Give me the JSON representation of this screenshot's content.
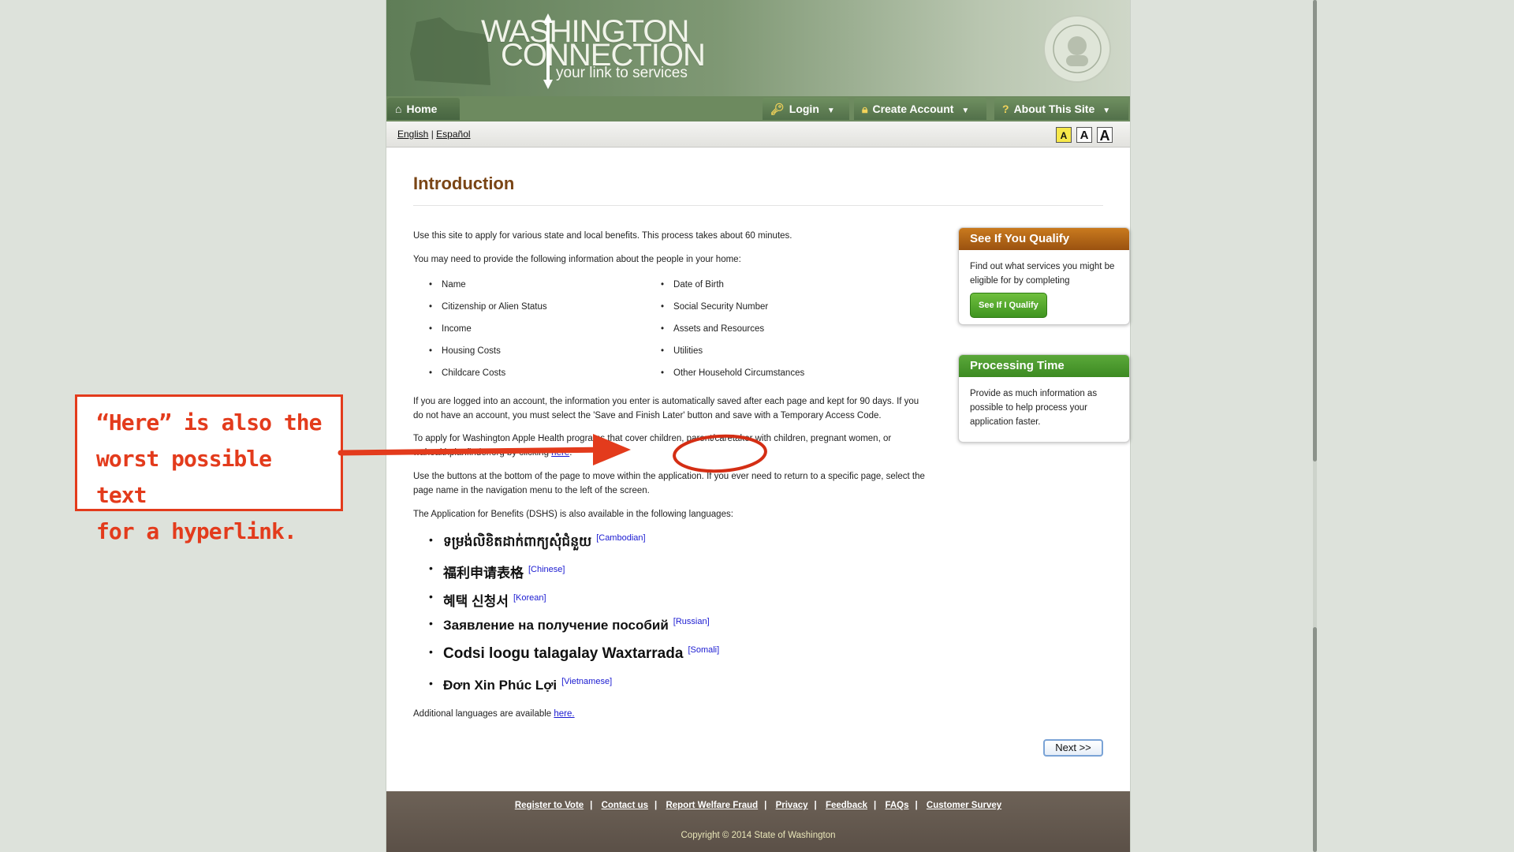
{
  "header": {
    "logo_line1": "WASHINGTON",
    "logo_line2": "CONNECTION",
    "tagline": "your link to services",
    "seal_icon": "state-seal-icon"
  },
  "nav": {
    "home": "Home",
    "login": "Login",
    "create_account": "Create Account",
    "about": "About This Site"
  },
  "langbar": {
    "english": "English",
    "separator": "|",
    "espanol": "Español",
    "size_small": "A",
    "size_medium": "A",
    "size_large": "A"
  },
  "main": {
    "title": "Introduction",
    "p1": "Use this site to apply for various state and local benefits.  This process takes about 60 minutes.",
    "p2": "You may need to provide the following information about the people in your home:",
    "info_left": [
      "Name",
      "Citizenship or Alien Status",
      "Income",
      "Housing Costs",
      "Childcare Costs"
    ],
    "info_right": [
      "Date of Birth",
      "Social Security Number",
      "Assets and Resources",
      "Utilities",
      "Other Household Circumstances"
    ],
    "p3": "If you are logged into an account, the information you enter is automatically saved after each page and kept for 90 days.  If you do not have an account, you must select the 'Save and Finish Later' button and save with a Temporary Access Code.",
    "p4_start": "To apply for Washington Apple Health programs that cover children, parent/caretaker with children, pregnant women, or",
    "p4_end": "wahealthplanfinder.org by clicking",
    "p4_link": "here",
    "p5": "Use the buttons at the bottom of the page to move within the application. If you ever need to return to a specific page, select the page name in the navigation menu to the left of the screen.",
    "p6": "The Application for Benefits (DSHS) is also available in the following languages:",
    "languages": [
      {
        "text": "ទម្រង់លិខិតដាក់ពាក្យសុំជំនួយ",
        "tag": "[Cambodian]"
      },
      {
        "text": "福利申请表格",
        "tag": "[Chinese]"
      },
      {
        "text": "혜택 신청서",
        "tag": "[Korean]"
      },
      {
        "text": "Заявление на получение пособий",
        "tag": "[Russian]"
      },
      {
        "text": "Codsi loogu talagalay Waxtarrada",
        "tag": "[Somali]"
      },
      {
        "text": "Đơn Xin Phúc Lợi",
        "tag": "[Vietnamese]"
      }
    ],
    "additional_text": "Additional languages are available",
    "additional_link": "here.",
    "next": "Next >>"
  },
  "sidebar": {
    "qualify_title": "See If You Qualify",
    "qualify_body": "Find out what services you might be eligible for by completing",
    "qualify_button": "See If I Qualify",
    "processing_title": "Processing Time",
    "processing_body": "Provide as much information as possible to help process your application faster."
  },
  "footer": {
    "links": [
      "Register to Vote",
      "Contact us",
      "Report Welfare Fraud",
      "Privacy",
      "Feedback",
      "FAQs",
      "Customer Survey"
    ],
    "copyright": "Copyright © 2014 State of Washington"
  },
  "annotation": {
    "line1": "“Here” is also the",
    "line2": "worst possible text",
    "line3": "for a hyperlink."
  },
  "colors": {
    "brand_green": "#6d8a5f",
    "title_brown": "#7a4515",
    "annotation_red": "#e33b1c",
    "link_blue": "#1a1ad1"
  }
}
